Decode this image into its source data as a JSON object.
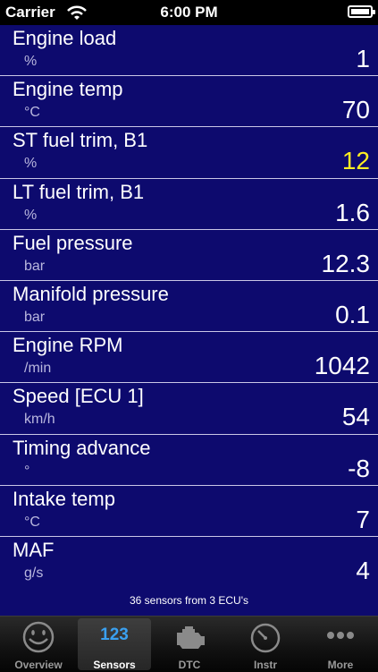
{
  "status_bar": {
    "carrier": "Carrier",
    "time": "6:00 PM"
  },
  "sensors": [
    {
      "name": "Engine load",
      "unit": "%",
      "value": "1",
      "warn": false
    },
    {
      "name": "Engine temp",
      "unit": "°C",
      "value": "70",
      "warn": false
    },
    {
      "name": "ST fuel trim, B1",
      "unit": "%",
      "value": "12",
      "warn": true
    },
    {
      "name": "LT fuel trim, B1",
      "unit": "%",
      "value": "1.6",
      "warn": false
    },
    {
      "name": "Fuel pressure",
      "unit": "bar",
      "value": "12.3",
      "warn": false
    },
    {
      "name": "Manifold pressure",
      "unit": "bar",
      "value": "0.1",
      "warn": false
    },
    {
      "name": "Engine RPM",
      "unit": "/min",
      "value": "1042",
      "warn": false
    },
    {
      "name": "Speed [ECU 1]",
      "unit": "km/h",
      "value": "54",
      "warn": false
    },
    {
      "name": "Timing advance",
      "unit": "°",
      "value": "-8",
      "warn": false
    },
    {
      "name": "Intake temp",
      "unit": "°C",
      "value": "7",
      "warn": false
    },
    {
      "name": "MAF",
      "unit": "g/s",
      "value": "4",
      "warn": false
    }
  ],
  "footer_note": "36 sensors from 3 ECU's",
  "tabs": [
    {
      "label": "Overview",
      "icon": "smiley-icon",
      "active": false
    },
    {
      "label": "Sensors",
      "icon": "123",
      "active": true
    },
    {
      "label": "DTC",
      "icon": "engine-icon",
      "active": false
    },
    {
      "label": "Instr",
      "icon": "gauge-icon",
      "active": false
    },
    {
      "label": "More",
      "icon": "more-dots-icon",
      "active": false
    }
  ],
  "colors": {
    "background": "#0d0a6e",
    "warn_value": "#ffee22",
    "active_tab_icon": "#3aa0f0"
  }
}
